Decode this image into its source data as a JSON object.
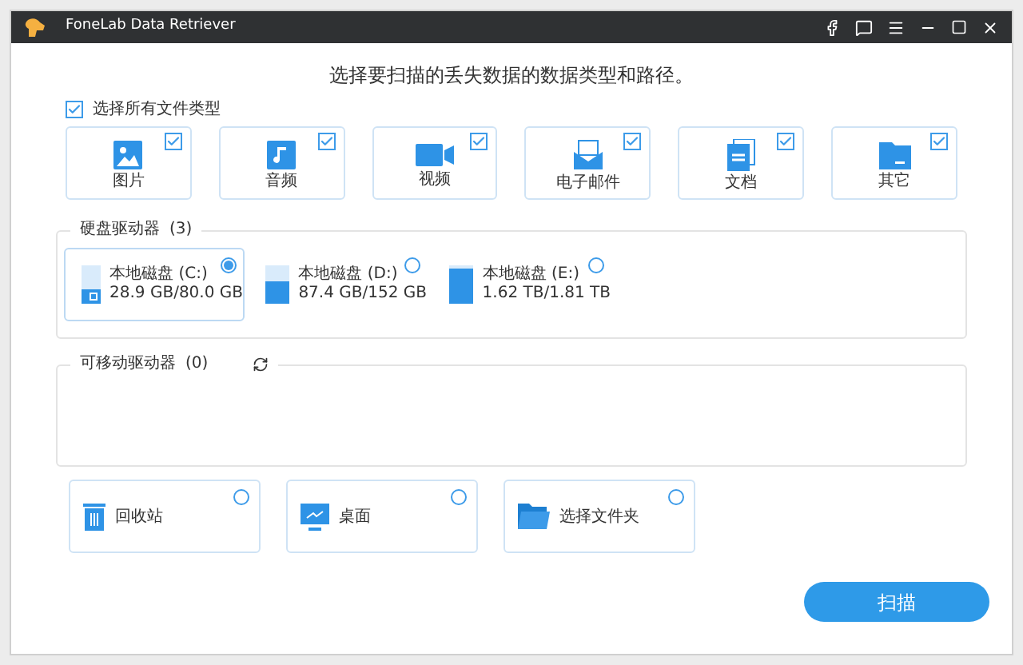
{
  "window": {
    "title": "FoneLab Data Retriever"
  },
  "heading": "选择要扫描的丢失数据的数据类型和路径。",
  "select_all": {
    "label": "选择所有文件类型",
    "checked": true
  },
  "file_types": [
    {
      "kind": "image",
      "label": "图片",
      "checked": true
    },
    {
      "kind": "audio",
      "label": "音频",
      "checked": true
    },
    {
      "kind": "video",
      "label": "视频",
      "checked": true
    },
    {
      "kind": "email",
      "label": "电子邮件",
      "checked": true
    },
    {
      "kind": "document",
      "label": "文档",
      "checked": true
    },
    {
      "kind": "other",
      "label": "其它",
      "checked": true
    }
  ],
  "hard_drives": {
    "title": "硬盘驱动器",
    "count": "(3)",
    "drives": [
      {
        "name": "本地磁盘 (C:)",
        "usage": "28.9 GB/80.0 GB",
        "level": 0.36,
        "system": true,
        "selected": true
      },
      {
        "name": "本地磁盘 (D:)",
        "usage": "87.4 GB/152 GB",
        "level": 0.58,
        "system": false,
        "selected": false
      },
      {
        "name": "本地磁盘 (E:)",
        "usage": "1.62 TB/1.81 TB",
        "level": 0.9,
        "system": false,
        "selected": false
      }
    ]
  },
  "removable_drives": {
    "title": "可移动驱动器",
    "count": "(0)"
  },
  "locations": [
    {
      "kind": "recycle",
      "label": "回收站",
      "selected": false
    },
    {
      "kind": "desktop",
      "label": "桌面",
      "selected": false
    },
    {
      "kind": "folder",
      "label": "选择文件夹",
      "selected": false
    }
  ],
  "scan_button": "扫描"
}
